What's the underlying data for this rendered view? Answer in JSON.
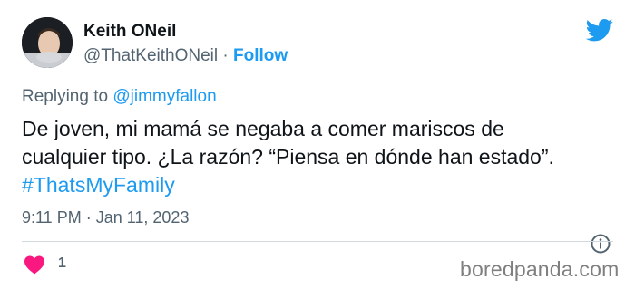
{
  "author": {
    "display_name": "Keith ONeil",
    "handle": "@ThatKeithONeil",
    "separator": " · ",
    "follow_label": "Follow"
  },
  "reply": {
    "prefix": "Replying to ",
    "mention": "@jimmyfallon"
  },
  "tweet": {
    "line1": "De joven, mi mamá se negaba a comer mariscos de",
    "line2": "cualquier tipo. ¿La razón? “Piensa en dónde han estado”.",
    "hashtag": "#ThatsMyFamily"
  },
  "meta": {
    "time": "9:11 PM",
    "separator": " · ",
    "date": "Jan 11, 2023"
  },
  "engagement": {
    "likes": "1"
  },
  "icons": {
    "brand": "twitter-bird-icon",
    "info": "info-icon",
    "like": "heart-icon"
  },
  "colors": {
    "accent": "#1d9bf0",
    "like": "#f91880",
    "secondary_text": "#536471"
  },
  "watermark": "boredpanda.com"
}
